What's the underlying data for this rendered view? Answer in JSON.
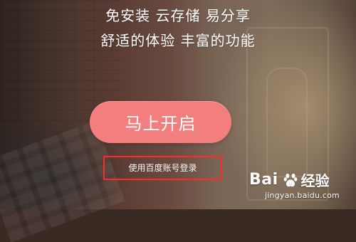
{
  "taglines": {
    "line1": "免安装 云存储 易分享",
    "line2": "舒适的体验 丰富的功能"
  },
  "actions": {
    "start_label": "马上开启",
    "login_label": "使用百度账号登录"
  },
  "watermark": {
    "brand_left": "Bai",
    "brand_right": "经验",
    "url": "jingyan.baidu.com",
    "icon": "paw-icon"
  },
  "colors": {
    "start_button": "#f27e7e",
    "highlight_border": "#ff2b2b",
    "text": "#ffffff"
  }
}
